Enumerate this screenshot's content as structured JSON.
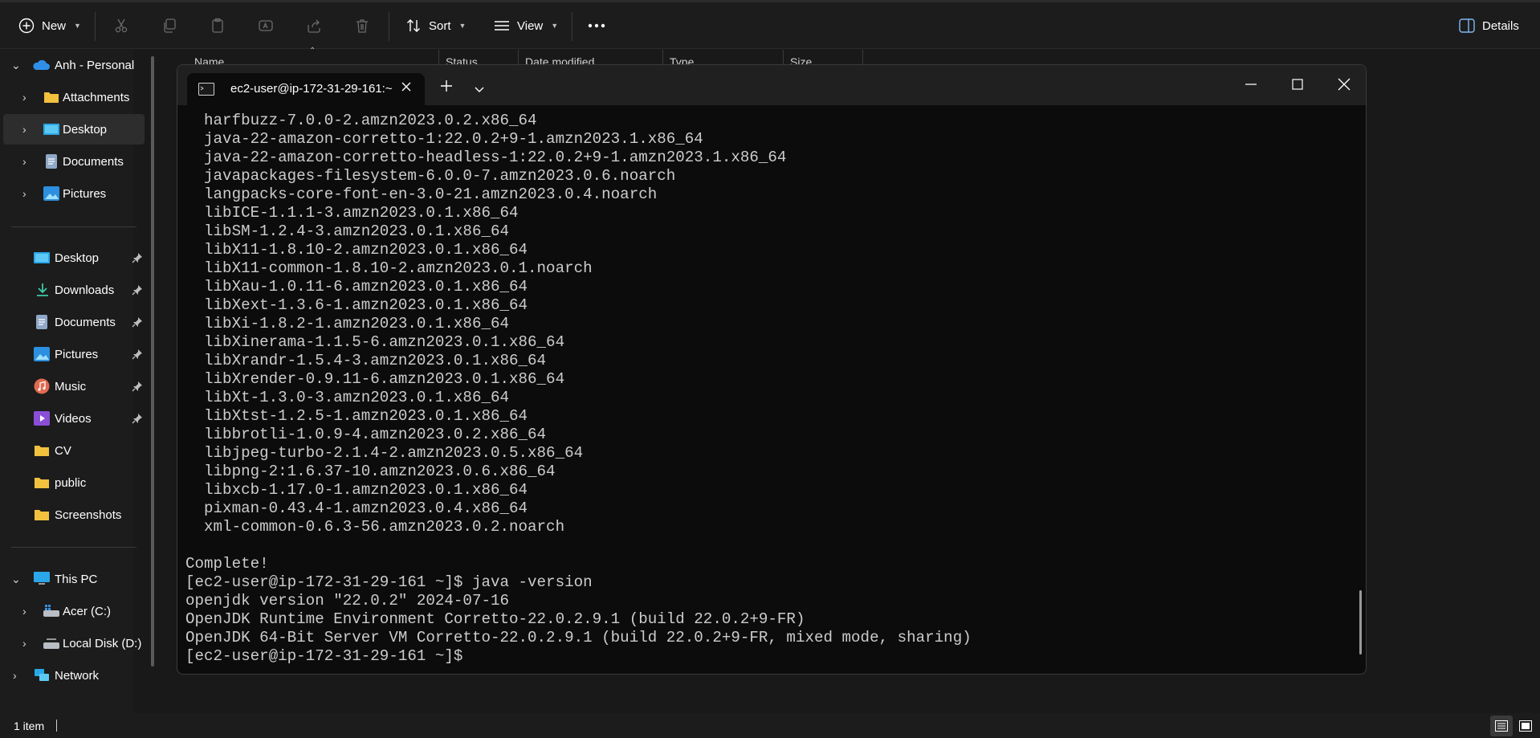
{
  "toolbar": {
    "new_label": "New",
    "sort_label": "Sort",
    "view_label": "View",
    "details_label": "Details"
  },
  "sidebar": {
    "account": "Anh - Personal",
    "tree": [
      "Attachments",
      "Desktop",
      "Documents",
      "Pictures"
    ],
    "quick_access": [
      "Desktop",
      "Downloads",
      "Documents",
      "Pictures",
      "Music",
      "Videos",
      "CV",
      "public",
      "Screenshots"
    ],
    "this_pc": "This PC",
    "drives": [
      "Acer (C:)",
      "Local Disk (D:)"
    ],
    "network": "Network"
  },
  "columns": [
    "Name",
    "Status",
    "Date modified",
    "Type",
    "Size"
  ],
  "status": {
    "items": "1 item"
  },
  "terminal": {
    "tab_title": "ec2-user@ip-172-31-29-161:~",
    "lines": [
      "  harfbuzz-7.0.0-2.amzn2023.0.2.x86_64",
      "  java-22-amazon-corretto-1:22.0.2+9-1.amzn2023.1.x86_64",
      "  java-22-amazon-corretto-headless-1:22.0.2+9-1.amzn2023.1.x86_64",
      "  javapackages-filesystem-6.0.0-7.amzn2023.0.6.noarch",
      "  langpacks-core-font-en-3.0-21.amzn2023.0.4.noarch",
      "  libICE-1.1.1-3.amzn2023.0.1.x86_64",
      "  libSM-1.2.4-3.amzn2023.0.1.x86_64",
      "  libX11-1.8.10-2.amzn2023.0.1.x86_64",
      "  libX11-common-1.8.10-2.amzn2023.0.1.noarch",
      "  libXau-1.0.11-6.amzn2023.0.1.x86_64",
      "  libXext-1.3.6-1.amzn2023.0.1.x86_64",
      "  libXi-1.8.2-1.amzn2023.0.1.x86_64",
      "  libXinerama-1.1.5-6.amzn2023.0.1.x86_64",
      "  libXrandr-1.5.4-3.amzn2023.0.1.x86_64",
      "  libXrender-0.9.11-6.amzn2023.0.1.x86_64",
      "  libXt-1.3.0-3.amzn2023.0.1.x86_64",
      "  libXtst-1.2.5-1.amzn2023.0.1.x86_64",
      "  libbrotli-1.0.9-4.amzn2023.0.2.x86_64",
      "  libjpeg-turbo-2.1.4-2.amzn2023.0.5.x86_64",
      "  libpng-2:1.6.37-10.amzn2023.0.6.x86_64",
      "  libxcb-1.17.0-1.amzn2023.0.1.x86_64",
      "  pixman-0.43.4-1.amzn2023.0.4.x86_64",
      "  xml-common-0.6.3-56.amzn2023.0.2.noarch",
      "",
      "Complete!",
      "[ec2-user@ip-172-31-29-161 ~]$ java -version",
      "openjdk version \"22.0.2\" 2024-07-16",
      "OpenJDK Runtime Environment Corretto-22.0.2.9.1 (build 22.0.2+9-FR)",
      "OpenJDK 64-Bit Server VM Corretto-22.0.2.9.1 (build 22.0.2+9-FR, mixed mode, sharing)",
      "[ec2-user@ip-172-31-29-161 ~]$ "
    ]
  },
  "colors": {
    "folder": "#f2c13d",
    "accent_blue": "#3b8fe0",
    "terminal_bg": "#0c0c0c",
    "terminal_text": "#cccccc"
  }
}
